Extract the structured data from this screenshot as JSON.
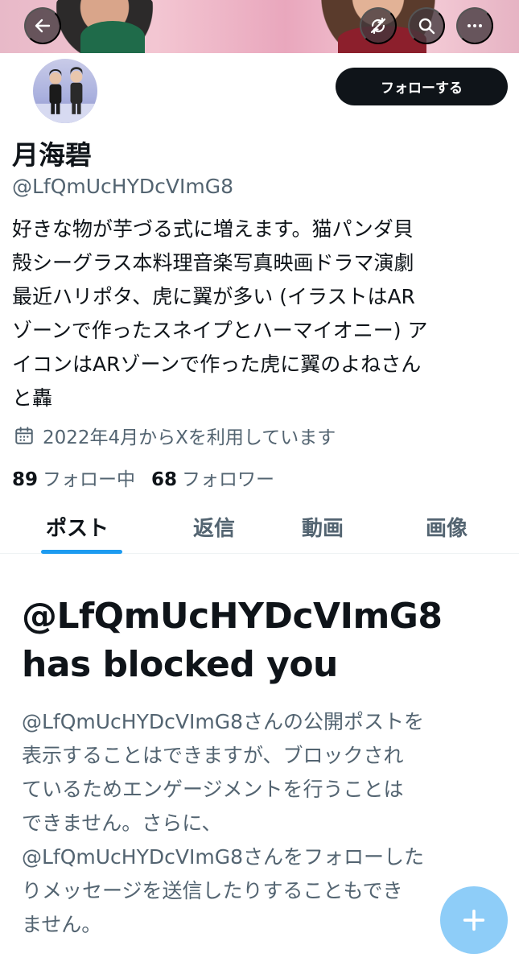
{
  "header": {
    "back_icon": "arrow-left-icon",
    "actions": [
      "sync-icon",
      "search-icon",
      "more-icon"
    ],
    "banner_colors": [
      "#e8b9c8",
      "#f3c6d2",
      "#e9a7bd"
    ]
  },
  "profile": {
    "follow_label": "フォローする",
    "display_name": "月海碧",
    "handle": "@LfQmUcHYDcVImG8",
    "bio_lines": [
      "好きな物が芋づる式に増えます。猫パンダ貝",
      "殻シーグラス本料理音楽写真映画ドラマ演劇",
      "最近ハリポタ、虎に翼が多い (イラストはAR",
      "ゾーンで作ったスネイプとハーマイオニー) ア",
      "イコンはARゾーンで作った虎に翼のよねさん",
      "と轟"
    ],
    "joined": "2022年4月からXを利用しています",
    "following_count": "89",
    "following_label": "フォロー中",
    "followers_count": "68",
    "followers_label": "フォロワー"
  },
  "tabs": [
    {
      "label": "ポスト",
      "active": true
    },
    {
      "label": "返信",
      "active": false
    },
    {
      "label": "動画",
      "active": false
    },
    {
      "label": "画像",
      "active": false
    }
  ],
  "blocked": {
    "title_lines": [
      "@LfQmUcHYDcVImG8",
      "has blocked you"
    ],
    "message_lines": [
      "@LfQmUcHYDcVImG8さんの公開ポストを",
      "表示することはできますが、ブロックされ",
      "ているためエンゲージメントを行うことは",
      "できません。さらに、",
      "@LfQmUcHYDcVImG8さんをフォローした",
      "りメッセージを送信したりすることもでき",
      "ません。"
    ]
  },
  "fab": {
    "icon": "plus-icon",
    "color": "#8ecdf8"
  },
  "colors": {
    "accent": "#1d9bf0",
    "text": "#0f1419",
    "secondary": "#536471"
  }
}
